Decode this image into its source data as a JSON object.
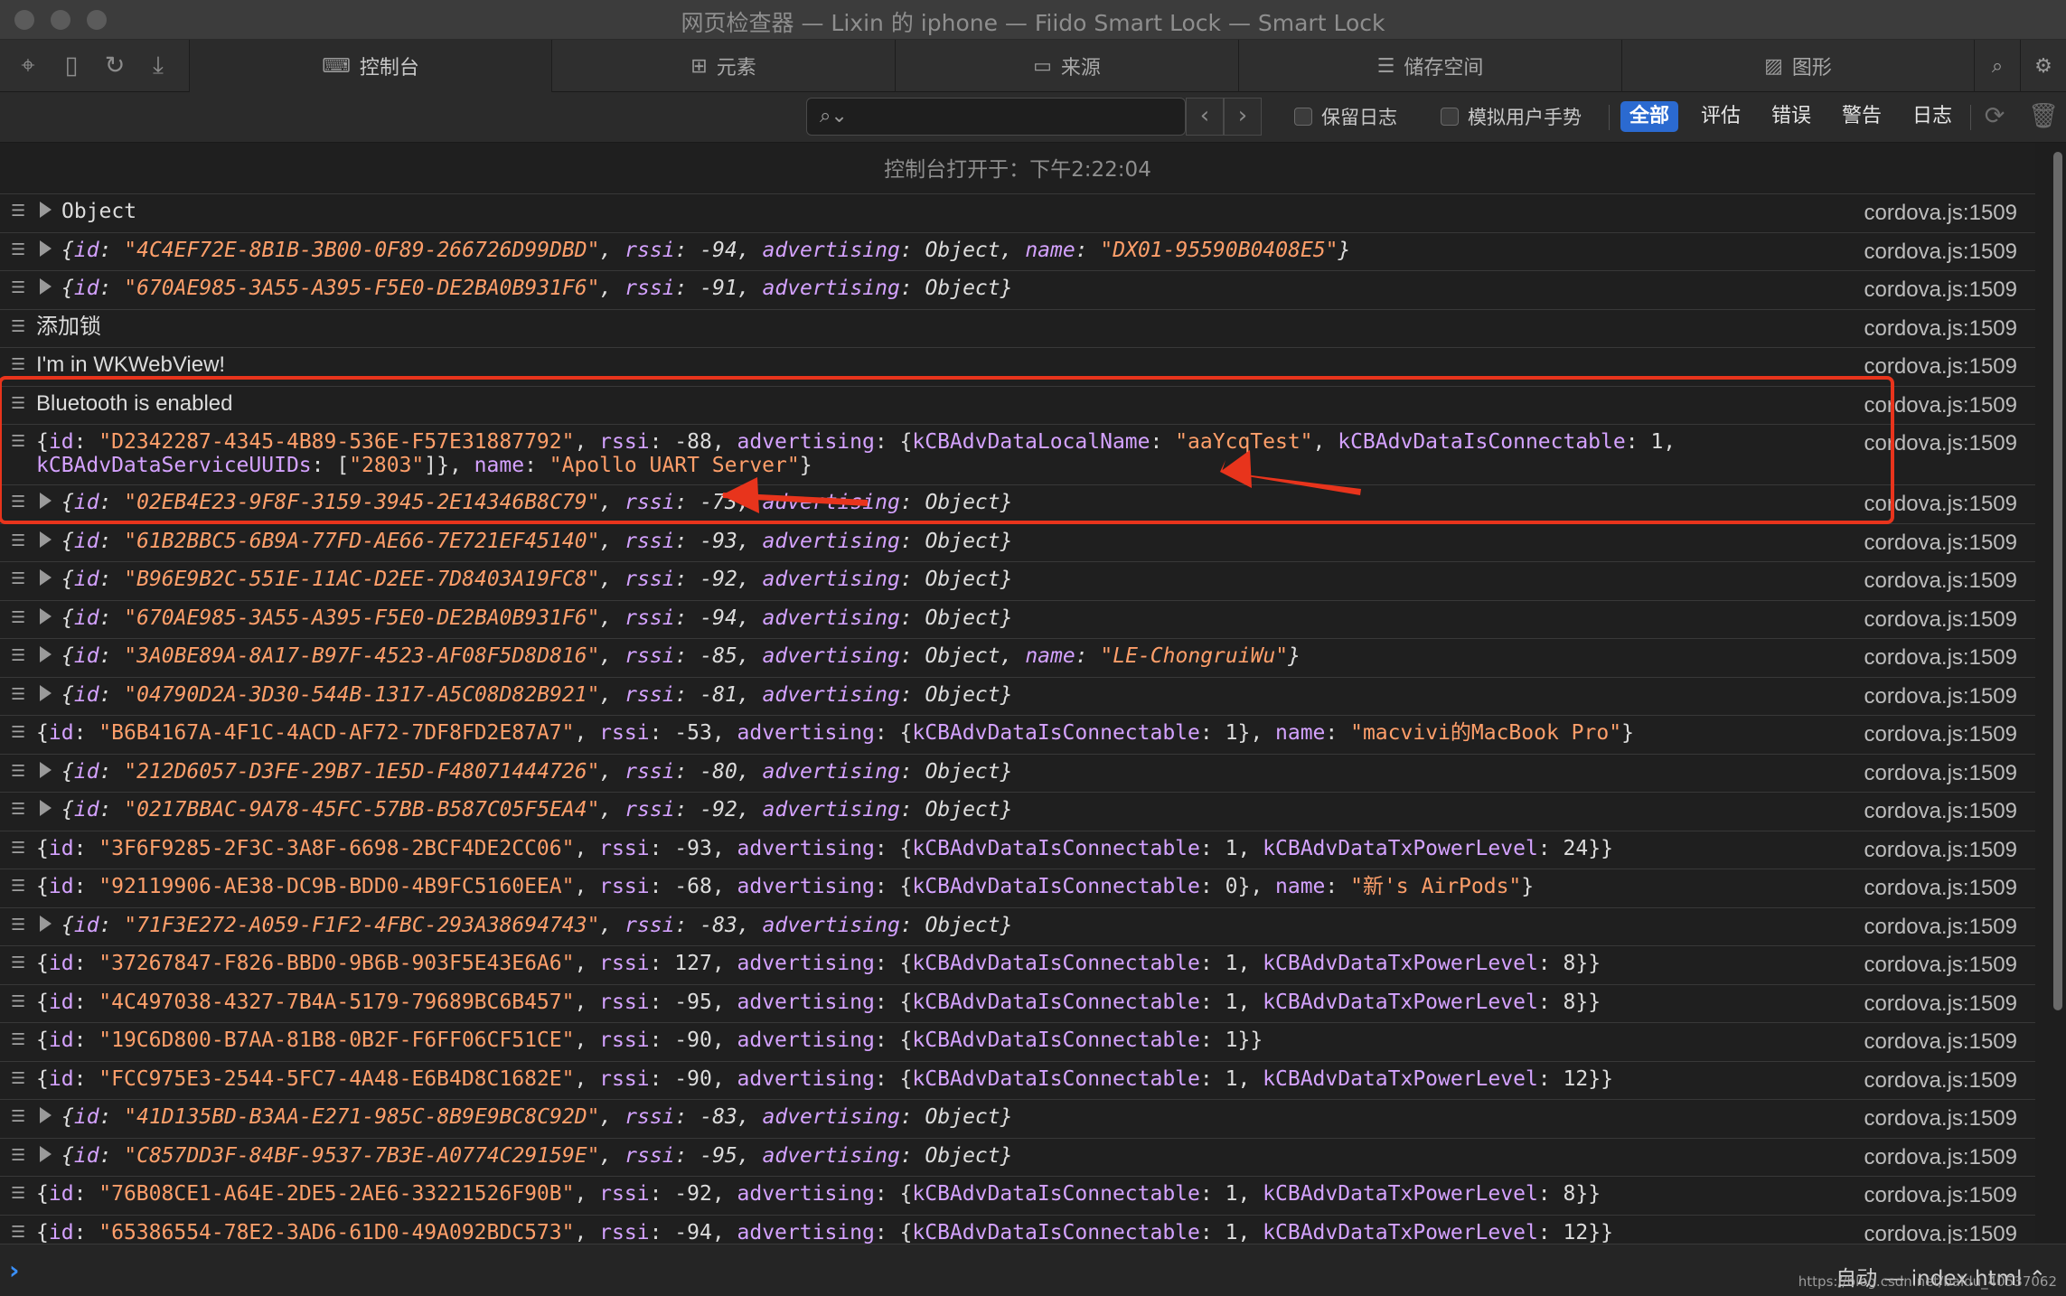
{
  "window": {
    "title": "网页检查器 — Lixin 的 iphone — Fiido Smart Lock — Smart Lock"
  },
  "toolbar": {
    "icons": [
      "crosshair-icon",
      "device-icon",
      "reload-icon",
      "download-icon"
    ],
    "tabs": [
      {
        "label": "控制台",
        "icon": "console-icon"
      },
      {
        "label": "元素",
        "icon": "elements-icon"
      },
      {
        "label": "来源",
        "icon": "document-icon"
      },
      {
        "label": "储存空间",
        "icon": "database-icon"
      },
      {
        "label": "图形",
        "icon": "image-icon"
      }
    ],
    "right_icons": [
      "search-icon",
      "gear-icon"
    ]
  },
  "filterbar": {
    "search_value": "",
    "preserve_log": "保留日志",
    "simulate_gesture": "模拟用户手势",
    "levels": [
      "全部",
      "评估",
      "错误",
      "警告",
      "日志"
    ],
    "active_level": "全部"
  },
  "console": {
    "opened_at": "控制台打开于：下午2:22:04",
    "source": "cordova.js:1509",
    "rows": [
      {
        "kind": "plain-mono",
        "arrow": true,
        "text": "Object"
      },
      {
        "kind": "obj",
        "arrow": true,
        "id": "4C4EF72E-8B1B-3B00-0F89-266726D99DBD",
        "rssi": "-94",
        "name": "DX01-95590B0408E5"
      },
      {
        "kind": "obj",
        "arrow": true,
        "id": "670AE985-3A55-A395-F5E0-DE2BA0B931F6",
        "rssi": "-91"
      },
      {
        "kind": "text",
        "text": "添加锁"
      },
      {
        "kind": "text",
        "text": "I'm in WKWebView!"
      },
      {
        "kind": "text",
        "text": "Bluetooth is enabled"
      },
      {
        "kind": "expanded",
        "id": "D2342287-4345-4B89-536E-F57E31887792",
        "rssi": "-88",
        "local_name": "aaYcqTest",
        "connectable": "1",
        "uuids": "2803",
        "name": "Apollo UART Server"
      },
      {
        "kind": "obj",
        "arrow": true,
        "id": "02EB4E23-9F8F-3159-3945-2E14346B8C79",
        "rssi": "-73"
      },
      {
        "kind": "obj",
        "arrow": true,
        "id": "61B2BBC5-6B9A-77FD-AE66-7E721EF45140",
        "rssi": "-93"
      },
      {
        "kind": "obj",
        "arrow": true,
        "id": "B96E9B2C-551E-11AC-D2EE-7D8403A19FC8",
        "rssi": "-92"
      },
      {
        "kind": "obj",
        "arrow": true,
        "id": "670AE985-3A55-A395-F5E0-DE2BA0B931F6",
        "rssi": "-94"
      },
      {
        "kind": "obj",
        "arrow": true,
        "id": "3A0BE89A-8A17-B97F-4523-AF08F5D8D816",
        "rssi": "-85",
        "name": "LE-ChongruiWu"
      },
      {
        "kind": "obj",
        "arrow": true,
        "id": "04790D2A-3D30-544B-1317-A5C08D82B921",
        "rssi": "-81"
      },
      {
        "kind": "conn",
        "id": "B6B4167A-4F1C-4ACD-AF72-7DF8FD2E87A7",
        "rssi": "-53",
        "connectable": "1",
        "name": "macvivi的MacBook Pro"
      },
      {
        "kind": "obj",
        "arrow": true,
        "id": "212D6057-D3FE-29B7-1E5D-F48071444726",
        "rssi": "-80"
      },
      {
        "kind": "obj",
        "arrow": true,
        "id": "0217BBAC-9A78-45FC-57BB-B587C05F5EA4",
        "rssi": "-92"
      },
      {
        "kind": "tx",
        "id": "3F6F9285-2F3C-3A8F-6698-2BCF4DE2CC06",
        "rssi": "-93",
        "connectable": "1",
        "tx": "24"
      },
      {
        "kind": "conn",
        "id": "92119906-AE38-DC9B-BDD0-4B9FC5160EEA",
        "rssi": "-68",
        "connectable": "0",
        "name": "新's AirPods"
      },
      {
        "kind": "obj",
        "arrow": true,
        "id": "71F3E272-A059-F1F2-4FBC-293A38694743",
        "rssi": "-83"
      },
      {
        "kind": "tx",
        "id": "37267847-F826-BBD0-9B6B-903F5E43E6A6",
        "rssi": "127",
        "connectable": "1",
        "tx": "8"
      },
      {
        "kind": "tx",
        "id": "4C497038-4327-7B4A-5179-79689BC6B457",
        "rssi": "-95",
        "connectable": "1",
        "tx": "8"
      },
      {
        "kind": "conn",
        "id": "19C6D800-B7AA-81B8-0B2F-F6FF06CF51CE",
        "rssi": "-90",
        "connectable": "1"
      },
      {
        "kind": "tx",
        "id": "FCC975E3-2544-5FC7-4A48-E6B4D8C1682E",
        "rssi": "-90",
        "connectable": "1",
        "tx": "12"
      },
      {
        "kind": "obj",
        "arrow": true,
        "id": "41D135BD-B3AA-E271-985C-8B9E9BC8C92D",
        "rssi": "-83"
      },
      {
        "kind": "obj",
        "arrow": true,
        "id": "C857DD3F-84BF-9537-7B3E-A0774C29159E",
        "rssi": "-95"
      },
      {
        "kind": "tx",
        "id": "76B08CE1-A64E-2DE5-2AE6-33221526F90B",
        "rssi": "-92",
        "connectable": "1",
        "tx": "8"
      },
      {
        "kind": "tx",
        "id": "65386554-78E2-3AD6-61D0-49A092BDC573",
        "rssi": "-94",
        "connectable": "1",
        "tx": "12"
      }
    ]
  },
  "bottom": {
    "context": "自动 — index.html ⌃",
    "watermark": "https://blog.csdn.net/baidu_40537062"
  },
  "colors": {
    "annotation": "#e8341c",
    "accent": "#2b6ad0",
    "key": "#d4a2ff",
    "string": "#ff9f6a"
  }
}
